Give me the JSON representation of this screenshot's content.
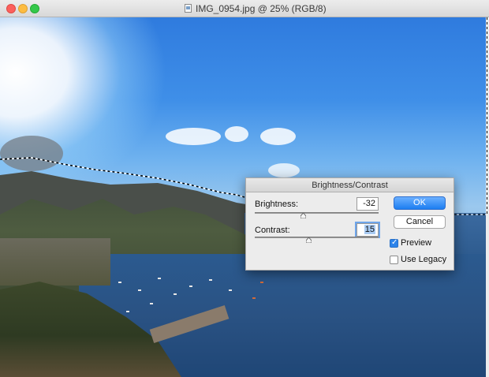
{
  "window": {
    "title": "IMG_0954.jpg @ 25% (RGB/8)"
  },
  "dialog": {
    "title": "Brightness/Contrast",
    "brightness": {
      "label": "Brightness:",
      "value": "-32",
      "level": -32,
      "range": [
        -150,
        150
      ]
    },
    "contrast": {
      "label": "Contrast:",
      "value": "15",
      "level": 15,
      "range": [
        -50,
        100
      ]
    },
    "ok_label": "OK",
    "cancel_label": "Cancel",
    "preview": {
      "label": "Preview",
      "checked": true
    },
    "use_legacy": {
      "label": "Use Legacy",
      "checked": false
    }
  },
  "colors": {
    "accent": "#1c7df1",
    "close": "#fc605c",
    "minimize": "#fdbc40",
    "maximize": "#34c84a"
  },
  "icons": {
    "document": "document-icon",
    "slider_thumb": "triangle-slider-thumb"
  }
}
